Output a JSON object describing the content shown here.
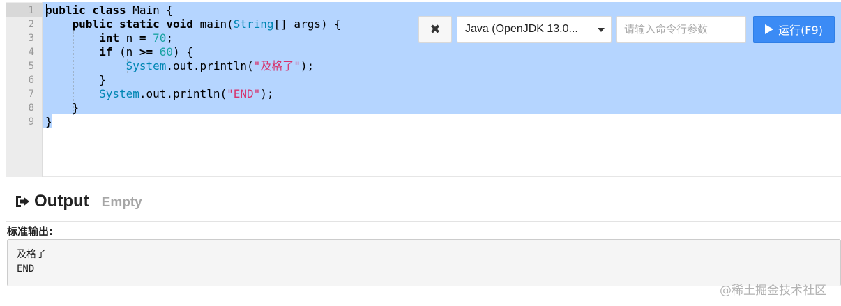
{
  "editor": {
    "line_numbers": [
      "1",
      "2",
      "3",
      "4",
      "5",
      "6",
      "7",
      "8",
      "9"
    ],
    "code": {
      "l1": {
        "kw1": "public",
        "kw2": "class",
        "rest": " Main {"
      },
      "l2": {
        "indent": "    ",
        "kw1": "public",
        "kw2": "static",
        "kw3": "void",
        "rest1": " main(",
        "type": "String",
        "rest2": "[] args) {"
      },
      "l3": {
        "indent": "        ",
        "kw": "int",
        "rest1": " n ",
        "op": "=",
        "rest2": " ",
        "num": "70",
        "rest3": ";"
      },
      "l4": {
        "indent": "        ",
        "kw": "if",
        "rest1": " (n ",
        "op": ">=",
        "rest2": " ",
        "num": "60",
        "rest3": ") {"
      },
      "l5": {
        "indent": "            ",
        "type": "System",
        "rest1": ".out.println(",
        "str": "\"及格了\"",
        "rest2": ");"
      },
      "l6": {
        "indent": "        ",
        "rest": "}"
      },
      "l7": {
        "indent": "        ",
        "type": "System",
        "rest1": ".out.println(",
        "str": "\"END\"",
        "rest2": ");"
      },
      "l8": {
        "indent": "    ",
        "rest": "}"
      },
      "l9": {
        "rest": "}"
      }
    }
  },
  "toolbar": {
    "clear_glyph": "✖",
    "language": "Java (OpenJDK 13.0...",
    "args_placeholder": "请输入命令行参数",
    "args_value": "",
    "run_label": "运行(F9)"
  },
  "output": {
    "title": "Output",
    "status": "Empty",
    "stdout_label": "标准输出:",
    "stdout_lines": [
      "及格了",
      "END"
    ]
  },
  "watermark": "@稀土掘金技术社区",
  "colors": {
    "selection": "#b5d5ff",
    "run_button": "#3b8bf5",
    "keyword_type": "#0086b3",
    "number": "#1aa3a3",
    "string": "#d6336c"
  }
}
